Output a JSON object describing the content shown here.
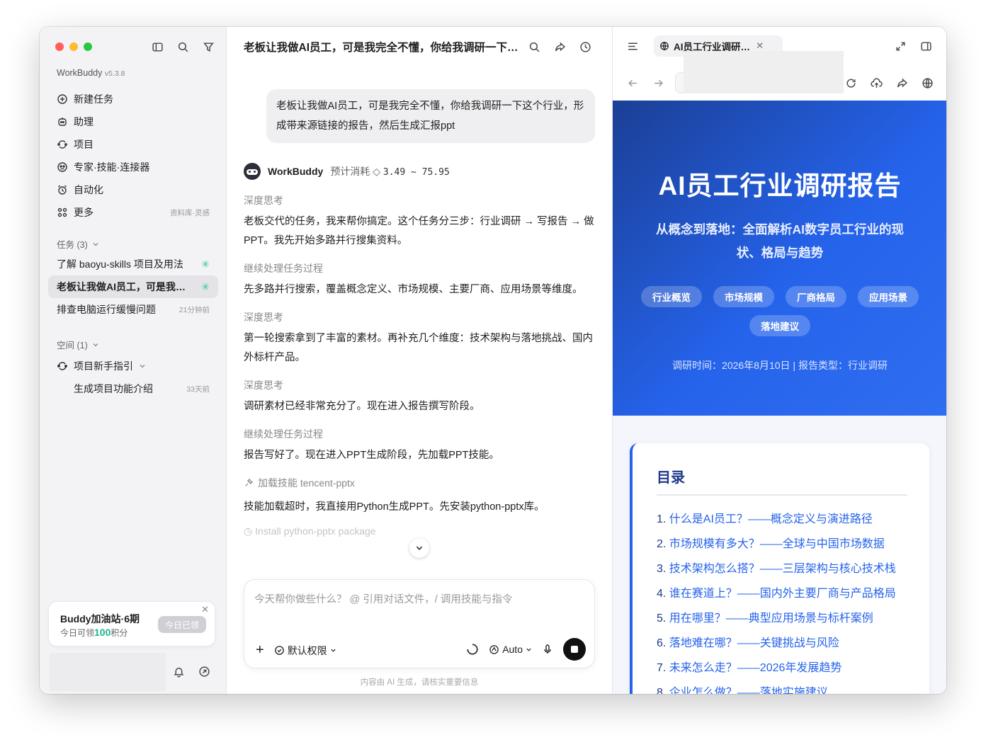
{
  "sidebar": {
    "brand": "WorkBuddy",
    "version": "v5.3.8",
    "nav": [
      {
        "label": "新建任务",
        "icon": "plus-circle-icon"
      },
      {
        "label": "助理",
        "icon": "robot-icon"
      },
      {
        "label": "项目",
        "icon": "project-icon"
      },
      {
        "label": "专家·技能·连接器",
        "icon": "expert-icon"
      },
      {
        "label": "自动化",
        "icon": "alarm-clock-icon"
      },
      {
        "label": "更多",
        "icon": "grid-icon",
        "hint": "资料库·灵感"
      }
    ],
    "tasks_title": "任务 (3)",
    "tasks": [
      {
        "label": "了解 baoyu-skills 项目及用法",
        "meta": ""
      },
      {
        "label": "老板让我做AI员工，可是我完全不懂，你给我调研一下这个行业",
        "meta": ""
      },
      {
        "label": "排查电脑运行缓慢问题",
        "meta": "21分钟前"
      }
    ],
    "spaces_title": "空间 (1)",
    "space": {
      "label": "项目新手指引",
      "child": "生成项目功能介绍",
      "child_meta": "33天前"
    },
    "promo": {
      "title": "Buddy加油站·6期",
      "sub_prefix": "今日可领",
      "points": "100",
      "sub_suffix": "积分",
      "button": "今日已领"
    }
  },
  "chat": {
    "title": "老板让我做AI员工，可是我完全不懂，你给我调研一下这个行业",
    "user_message": "老板让我做AI员工，可是我完全不懂，你给我调研一下这个行业，形成带来源链接的报告，然后生成汇报ppt",
    "agent_name": "WorkBuddy",
    "cost_label": "预计消耗",
    "cost_value": "3.49 ~ 75.95",
    "steps": [
      {
        "kind": "think",
        "text": "深度思考"
      },
      {
        "kind": "para",
        "text": "老板交代的任务，我来帮你搞定。这个任务分三步：行业调研 → 写报告 → 做PPT。我先开始多路并行搜集资料。"
      },
      {
        "kind": "think",
        "text": "继续处理任务过程"
      },
      {
        "kind": "para",
        "text": "先多路并行搜索，覆盖概念定义、市场规模、主要厂商、应用场景等维度。"
      },
      {
        "kind": "think",
        "text": "深度思考"
      },
      {
        "kind": "para",
        "text": "第一轮搜索拿到了丰富的素材。再补充几个维度：技术架构与落地挑战、国内外标杆产品。"
      },
      {
        "kind": "think",
        "text": "深度思考"
      },
      {
        "kind": "para",
        "text": "调研素材已经非常充分了。现在进入报告撰写阶段。"
      },
      {
        "kind": "think",
        "text": "继续处理任务过程"
      },
      {
        "kind": "para",
        "text": "报告写好了。现在进入PPT生成阶段，先加载PPT技能。"
      }
    ],
    "skill_text": "加载技能 tencent-pptx",
    "last_para": "技能加载超时，我直接用Python生成PPT。先安装python-pptx库。",
    "faded": "Install python-pptx package",
    "composer_placeholder": "今天帮你做些什么？ @ 引用对话文件，/ 调用技能与指令",
    "permission": "默认权限",
    "model": "Auto",
    "disclaimer": "内容由 AI 生成，请核实重要信息"
  },
  "browser": {
    "tab_title": "AI员工行业调研报告",
    "url": "",
    "hero_title": "AI员工行业调研报告",
    "hero_sub": "从概念到落地：全面解析AI数字员工行业的现状、格局与趋势",
    "chips": [
      "行业概览",
      "市场规模",
      "厂商格局",
      "应用场景",
      "落地建议"
    ],
    "meta": "调研时间：2026年8月10日 | 报告类型：行业调研",
    "toc_title": "目录",
    "toc": [
      {
        "n": "1.",
        "t": "什么是AI员工？——概念定义与演进路径"
      },
      {
        "n": "2.",
        "t": "市场规模有多大？——全球与中国市场数据"
      },
      {
        "n": "3.",
        "t": "技术架构怎么搭？——三层架构与核心技术栈"
      },
      {
        "n": "4.",
        "t": "谁在赛道上？——国内外主要厂商与产品格局"
      },
      {
        "n": "5.",
        "t": "用在哪里？——典型应用场景与标杆案例"
      },
      {
        "n": "6.",
        "t": "落地难在哪？——关键挑战与风险"
      },
      {
        "n": "7.",
        "t": "未来怎么走？——2026年发展趋势"
      },
      {
        "n": "8.",
        "t": "企业怎么做？——落地实施建议"
      }
    ]
  }
}
